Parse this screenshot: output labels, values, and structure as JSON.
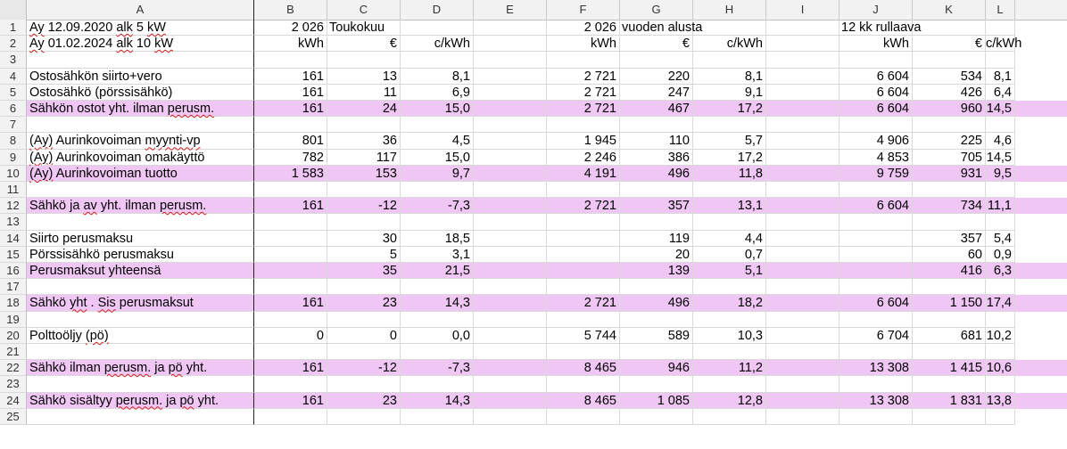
{
  "columns": [
    "A",
    "B",
    "C",
    "D",
    "E",
    "F",
    "G",
    "H",
    "I",
    "J",
    "K",
    "L"
  ],
  "rows": [
    {
      "n": "1",
      "a": "Ay 12.09.2020 alk   5 kW",
      "b": "2 026",
      "c": "Toukokuu",
      "d": "",
      "f": "2 026",
      "g": "vuoden alusta",
      "h": "",
      "j": "12 kk rullaava",
      "k": "",
      "l": "",
      "hl": false
    },
    {
      "n": "2",
      "a": "Ay 01.02.2024 alk 10 kW",
      "b": "kWh",
      "c": "€",
      "d": "c/kWh",
      "f": "kWh",
      "g": "€",
      "h": "c/kWh",
      "j": "kWh",
      "k": "€",
      "l": "c/kWh",
      "hl": false
    },
    {
      "n": "3",
      "a": "",
      "b": "",
      "c": "",
      "d": "",
      "f": "",
      "g": "",
      "h": "",
      "j": "",
      "k": "",
      "l": "",
      "hl": false
    },
    {
      "n": "4",
      "a": "Ostosähkön siirto+vero",
      "b": "161",
      "c": "13",
      "d": "8,1",
      "f": "2 721",
      "g": "220",
      "h": "8,1",
      "j": "6 604",
      "k": "534",
      "l": "8,1",
      "hl": false
    },
    {
      "n": "5",
      "a": "Ostosähkö (pörssisähkö)",
      "b": "161",
      "c": "11",
      "d": "6,9",
      "f": "2 721",
      "g": "247",
      "h": "9,1",
      "j": "6 604",
      "k": "426",
      "l": "6,4",
      "hl": false
    },
    {
      "n": "6",
      "a": "Sähkön ostot  yht. ilman perusm.",
      "b": "161",
      "c": "24",
      "d": "15,0",
      "f": "2 721",
      "g": "467",
      "h": "17,2",
      "j": "6 604",
      "k": "960",
      "l": "14,5",
      "hl": true
    },
    {
      "n": "7",
      "a": "",
      "b": "",
      "c": "",
      "d": "",
      "f": "",
      "g": "",
      "h": "",
      "j": "",
      "k": "",
      "l": "",
      "hl": false
    },
    {
      "n": "8",
      "a": "(Ay) Aurinkovoiman myynti-vp",
      "b": "801",
      "c": "36",
      "d": "4,5",
      "f": "1 945",
      "g": "110",
      "h": "5,7",
      "j": "4 906",
      "k": "225",
      "l": "4,6",
      "hl": false
    },
    {
      "n": "9",
      "a": "(Ay) Aurinkovoiman omakäyttö",
      "b": "782",
      "c": "117",
      "d": "15,0",
      "f": "2 246",
      "g": "386",
      "h": "17,2",
      "j": "4 853",
      "k": "705",
      "l": "14,5",
      "hl": false
    },
    {
      "n": "10",
      "a": "(Ay) Aurinkovoiman tuotto",
      "b": "1 583",
      "c": "153",
      "d": "9,7",
      "f": "4 191",
      "g": "496",
      "h": "11,8",
      "j": "9 759",
      "k": "931",
      "l": "9,5",
      "hl": true
    },
    {
      "n": "11",
      "a": "",
      "b": "",
      "c": "",
      "d": "",
      "f": "",
      "g": "",
      "h": "",
      "j": "",
      "k": "",
      "l": "",
      "hl": false
    },
    {
      "n": "12",
      "a": "Sähkö ja av yht. ilman perusm.",
      "b": "161",
      "c": "-12",
      "d": "-7,3",
      "f": "2 721",
      "g": "357",
      "h": "13,1",
      "j": "6 604",
      "k": "734",
      "l": "11,1",
      "hl": true
    },
    {
      "n": "13",
      "a": "",
      "b": "",
      "c": "",
      "d": "",
      "f": "",
      "g": "",
      "h": "",
      "j": "",
      "k": "",
      "l": "",
      "hl": false
    },
    {
      "n": "14",
      "a": "Siirto perusmaksu",
      "b": "",
      "c": "30",
      "d": "18,5",
      "f": "",
      "g": "119",
      "h": "4,4",
      "j": "",
      "k": "357",
      "l": "5,4",
      "hl": false
    },
    {
      "n": "15",
      "a": "Pörssisähkö perusmaksu",
      "b": "",
      "c": "5",
      "d": "3,1",
      "f": "",
      "g": "20",
      "h": "0,7",
      "j": "",
      "k": "60",
      "l": "0,9",
      "hl": false
    },
    {
      "n": "16",
      "a": "Perusmaksut yhteensä",
      "b": "",
      "c": "35",
      "d": "21,5",
      "f": "",
      "g": "139",
      "h": "5,1",
      "j": "",
      "k": "416",
      "l": "6,3",
      "hl": true
    },
    {
      "n": "17",
      "a": "",
      "b": "",
      "c": "",
      "d": "",
      "f": "",
      "g": "",
      "h": "",
      "j": "",
      "k": "",
      "l": "",
      "hl": false
    },
    {
      "n": "18",
      "a": "Sähkö yht . Sis perusmaksut",
      "b": "161",
      "c": "23",
      "d": "14,3",
      "f": "2 721",
      "g": "496",
      "h": "18,2",
      "j": "6 604",
      "k": "1 150",
      "l": "17,4",
      "hl": true
    },
    {
      "n": "19",
      "a": "",
      "b": "",
      "c": "",
      "d": "",
      "f": "",
      "g": "",
      "h": "",
      "j": "",
      "k": "",
      "l": "",
      "hl": false
    },
    {
      "n": "20",
      "a": "Polttoöljy (pö)",
      "b": "0",
      "c": "0",
      "d": "0,0",
      "f": "5 744",
      "g": "589",
      "h": "10,3",
      "j": "6 704",
      "k": "681",
      "l": "10,2",
      "hl": false
    },
    {
      "n": "21",
      "a": "",
      "b": "",
      "c": "",
      "d": "",
      "f": "",
      "g": "",
      "h": "",
      "j": "",
      "k": "",
      "l": "",
      "hl": false
    },
    {
      "n": "22",
      "a": "Sähkö ilman perusm. ja pö yht.",
      "b": "161",
      "c": "-12",
      "d": "-7,3",
      "f": "8 465",
      "g": "946",
      "h": "11,2",
      "j": "13 308",
      "k": "1 415",
      "l": "10,6",
      "hl": true
    },
    {
      "n": "23",
      "a": "",
      "b": "",
      "c": "",
      "d": "",
      "f": "",
      "g": "",
      "h": "",
      "j": "",
      "k": "",
      "l": "",
      "hl": false
    },
    {
      "n": "24",
      "a": "Sähkö sisältyy perusm. ja pö yht.",
      "b": "161",
      "c": "23",
      "d": "14,3",
      "f": "8 465",
      "g": "1 085",
      "h": "12,8",
      "j": "13 308",
      "k": "1 831",
      "l": "13,8",
      "hl": true
    },
    {
      "n": "25",
      "a": "",
      "b": "",
      "c": "",
      "d": "",
      "f": "",
      "g": "",
      "h": "",
      "j": "",
      "k": "",
      "l": "",
      "hl": false
    }
  ],
  "colors": {
    "highlight": "#f0c6f4",
    "grid": "#d9d9d9",
    "header_bg": "#f2f2f2"
  }
}
